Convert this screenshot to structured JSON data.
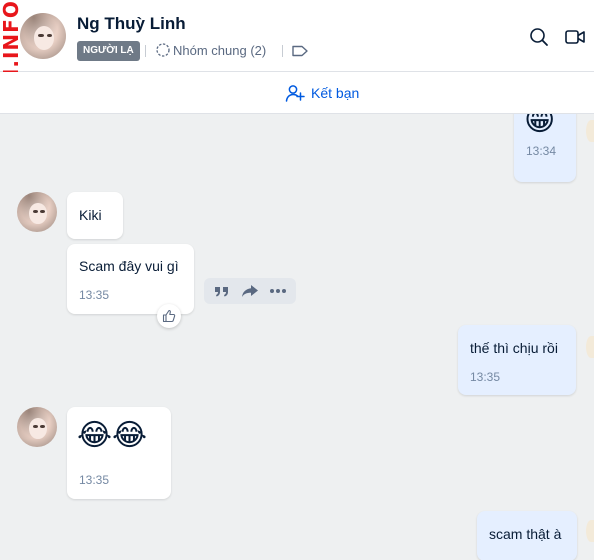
{
  "watermark": "AM.INFO",
  "header": {
    "name": "Ng Thuỳ Linh",
    "badge": "NGƯỜI LẠ",
    "groups": "Nhóm chung (2)",
    "icons": [
      "search-icon",
      "video-call-icon",
      "tag-icon",
      "group-icon"
    ]
  },
  "friendbar": {
    "label": "Kết bạn",
    "icon": "add-user-icon"
  },
  "messages": {
    "m1": {
      "direction": "out",
      "text": "😁",
      "time": "13:34"
    },
    "m2": {
      "direction": "in",
      "text": "Kiki"
    },
    "m3": {
      "direction": "in",
      "text": "Scam đây vui gì",
      "time": "13:35"
    },
    "m4": {
      "direction": "out",
      "text": "thế thì chịu rồi",
      "time": "13:35"
    },
    "m5": {
      "direction": "in",
      "text": "😂😂",
      "time": "13:35"
    },
    "m6": {
      "direction": "out",
      "text": "scam thật à"
    }
  },
  "message_actions": [
    "quote-icon",
    "forward-icon",
    "more-icon"
  ],
  "colors": {
    "accent": "#005ae0",
    "incoming_bubble": "#ffffff",
    "outgoing_bubble": "#e5efff",
    "background": "#eef0f1",
    "badge": "#6f7a87",
    "watermark": "#e8161b"
  }
}
